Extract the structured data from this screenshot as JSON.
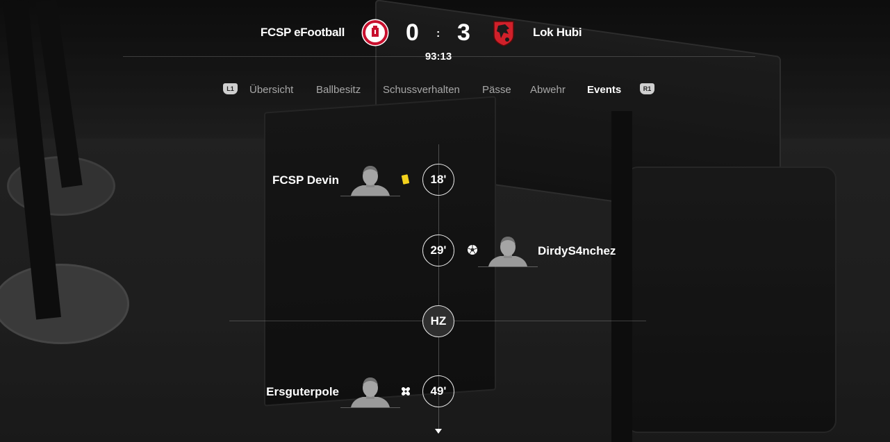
{
  "match": {
    "home_team": "FCSP eFootball",
    "away_team": "Lok Hubi",
    "home_score": "0",
    "away_score": "3",
    "separator": ":",
    "clock": "93:13"
  },
  "tabs": {
    "left_shoulder": "L1",
    "right_shoulder": "R1",
    "items": [
      "Übersicht",
      "Ballbesitz",
      "Schussverhalten",
      "Pässe",
      "Abwehr",
      "Events"
    ],
    "active": "Events"
  },
  "events": [
    {
      "minute": "18'",
      "side": "home",
      "player": "FCSP Devin",
      "type": "yellow-card"
    },
    {
      "minute": "29'",
      "side": "away",
      "player": "DirdyS4nchez",
      "type": "goal"
    },
    {
      "minute": "HZ",
      "side": "none",
      "player": "",
      "type": "half-time"
    },
    {
      "minute": "49'",
      "side": "home",
      "player": "Ersguterpole",
      "type": "injury"
    }
  ],
  "colors": {
    "yellow_card": "#f3d21d",
    "active_tab": "#ffffff",
    "inactive_tab": "#a8a8a8",
    "crest_home": "#c8102e",
    "crest_away": "#d0202a"
  }
}
